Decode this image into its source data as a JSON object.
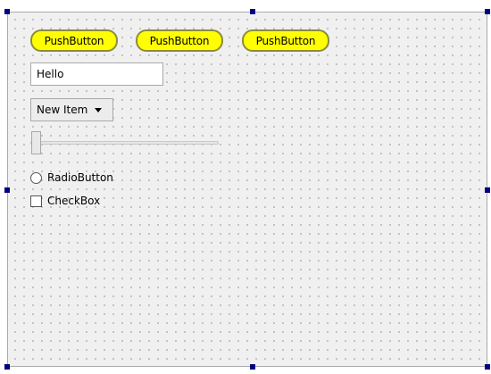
{
  "buttons": [
    {
      "label": "PushButton"
    },
    {
      "label": "PushButton"
    },
    {
      "label": "PushButton"
    }
  ],
  "line_edit": {
    "value": "Hello"
  },
  "combo": {
    "selected": "New Item"
  },
  "slider": {
    "value": 0
  },
  "radio": {
    "label": "RadioButton",
    "checked": false
  },
  "checkbox": {
    "label": "CheckBox",
    "checked": false
  },
  "colors": {
    "button_fill": "#ffff00",
    "selection_handle": "#000080"
  }
}
